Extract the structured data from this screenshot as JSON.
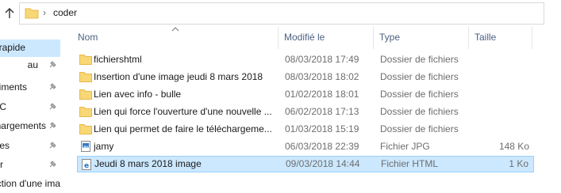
{
  "address": {
    "path_segment": "coder"
  },
  "nav": {
    "items": [
      {
        "label": "rapide",
        "pinned": false,
        "selected": true
      },
      {
        "label": "au",
        "pinned": true,
        "selected": false
      },
      {
        "label": "iments",
        "pinned": true,
        "selected": false
      },
      {
        "label": "C",
        "pinned": true,
        "selected": false
      },
      {
        "label": "hargements",
        "pinned": true,
        "selected": false
      },
      {
        "label": "es",
        "pinned": true,
        "selected": false
      },
      {
        "label": "r",
        "pinned": true,
        "selected": false
      },
      {
        "label": "ction d'une ima",
        "pinned": false,
        "selected": false
      }
    ]
  },
  "columns": {
    "name": "Nom",
    "modified": "Modifié le",
    "type": "Type",
    "size": "Taille"
  },
  "files": [
    {
      "name": "fichiershtml",
      "modified": "08/03/2018 17:49",
      "type": "Dossier de fichiers",
      "size": "",
      "icon": "folder-icon",
      "selected": false
    },
    {
      "name": "Insertion d'une image jeudi 8 mars 2018",
      "modified": "08/03/2018 18:02",
      "type": "Dossier de fichiers",
      "size": "",
      "icon": "folder-icon",
      "selected": false
    },
    {
      "name": "Lien avec info - bulle",
      "modified": "01/02/2018 18:01",
      "type": "Dossier de fichiers",
      "size": "",
      "icon": "folder-icon",
      "selected": false
    },
    {
      "name": "Lien qui force l'ouverture d'une nouvelle ...",
      "modified": "06/02/2018 17:13",
      "type": "Dossier de fichiers",
      "size": "",
      "icon": "folder-icon",
      "selected": false
    },
    {
      "name": "Lien qui permet de faire le téléchargeme...",
      "modified": "01/03/2018 15:19",
      "type": "Dossier de fichiers",
      "size": "",
      "icon": "folder-icon",
      "selected": false
    },
    {
      "name": "jamy",
      "modified": "06/03/2018 22:39",
      "type": "Fichier JPG",
      "size": "148 Ko",
      "icon": "image-file-icon",
      "selected": false
    },
    {
      "name": "Jeudi 8 mars 2018 image",
      "modified": "09/03/2018 14:44",
      "type": "Fichier HTML",
      "size": "1 Ko",
      "icon": "html-file-icon",
      "selected": true
    }
  ],
  "colors": {
    "selection": "#cce8ff",
    "selection_border": "#99d1ff",
    "header_text": "#4d6082",
    "folder": "#f8d775",
    "folder_dark": "#e8b94a",
    "edge_blue": "#1e73c8"
  }
}
